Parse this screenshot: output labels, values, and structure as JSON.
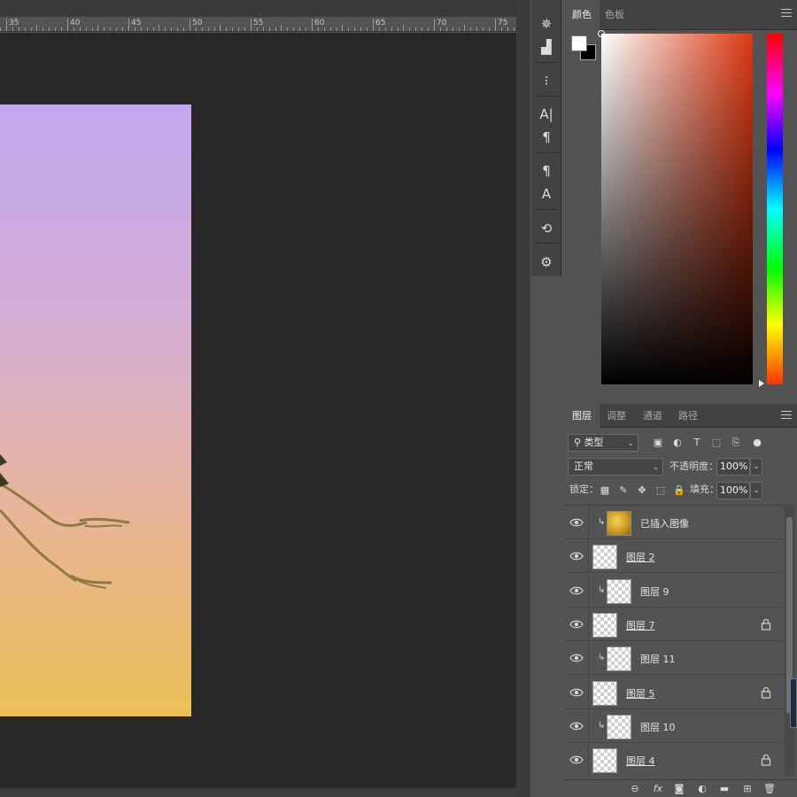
{
  "ruler": {
    "labels": [
      "35",
      "40",
      "45",
      "50",
      "55",
      "60",
      "65",
      "70",
      "75"
    ]
  },
  "tools": [
    {
      "icon": "navigator-wheel-icon",
      "glyph": "✵"
    },
    {
      "icon": "histogram-icon",
      "glyph": "▟"
    },
    {
      "icon": "brush-settings-icon",
      "glyph": "⁝"
    },
    {
      "icon": "character-icon",
      "glyph": "A|"
    },
    {
      "icon": "paragraph-icon",
      "glyph": "¶"
    },
    {
      "icon": "paragraph-styles-icon",
      "glyph": "¶"
    },
    {
      "icon": "character-styles-icon",
      "glyph": "A"
    },
    {
      "icon": "clone-source-icon",
      "glyph": "⟲"
    },
    {
      "icon": "properties-icon",
      "glyph": "⚙"
    }
  ],
  "color_panel": {
    "tabs": [
      "颜色",
      "色板"
    ],
    "active_tab": 0,
    "foreground": "#ffffff",
    "background": "#000000",
    "hue_color": "#de3810"
  },
  "layers_panel": {
    "tabs": [
      "图层",
      "调整",
      "通道",
      "路径"
    ],
    "active_tab": 0,
    "filter": {
      "value": "类型",
      "search_glyph": "⚲"
    },
    "blend_mode": "正常",
    "opacity_label": "不透明度：",
    "opacity_value": "100%",
    "lock_label": "锁定：",
    "fill_label": "填充：",
    "fill_value": "100%",
    "layers": [
      {
        "name": "已插入图像",
        "clipped": true,
        "thumb": "gold",
        "underline": false,
        "locked": false
      },
      {
        "name": "图层 2",
        "clipped": false,
        "thumb": "transparent",
        "underline": true,
        "locked": false
      },
      {
        "name": "图层 9",
        "clipped": true,
        "thumb": "transparent",
        "underline": false,
        "locked": false
      },
      {
        "name": "图层 7",
        "clipped": false,
        "thumb": "transparent",
        "underline": true,
        "locked": true
      },
      {
        "name": "图层 11",
        "clipped": true,
        "thumb": "transparent",
        "underline": false,
        "locked": false
      },
      {
        "name": "图层 5",
        "clipped": false,
        "thumb": "transparent",
        "underline": true,
        "locked": true
      },
      {
        "name": "图层 10",
        "clipped": true,
        "thumb": "transparent",
        "underline": false,
        "locked": false
      },
      {
        "name": "图层 4",
        "clipped": false,
        "thumb": "transparent",
        "underline": true,
        "locked": true
      }
    ],
    "footer_icons": [
      "link-layers-icon",
      "fx-icon",
      "layer-mask-icon",
      "adjustment-layer-icon",
      "group-folder-icon",
      "new-layer-icon",
      "delete-icon"
    ],
    "footer_glyphs": [
      "⊖",
      "fx",
      "◙",
      "◐",
      "▬",
      "⊞",
      "🗑"
    ]
  }
}
